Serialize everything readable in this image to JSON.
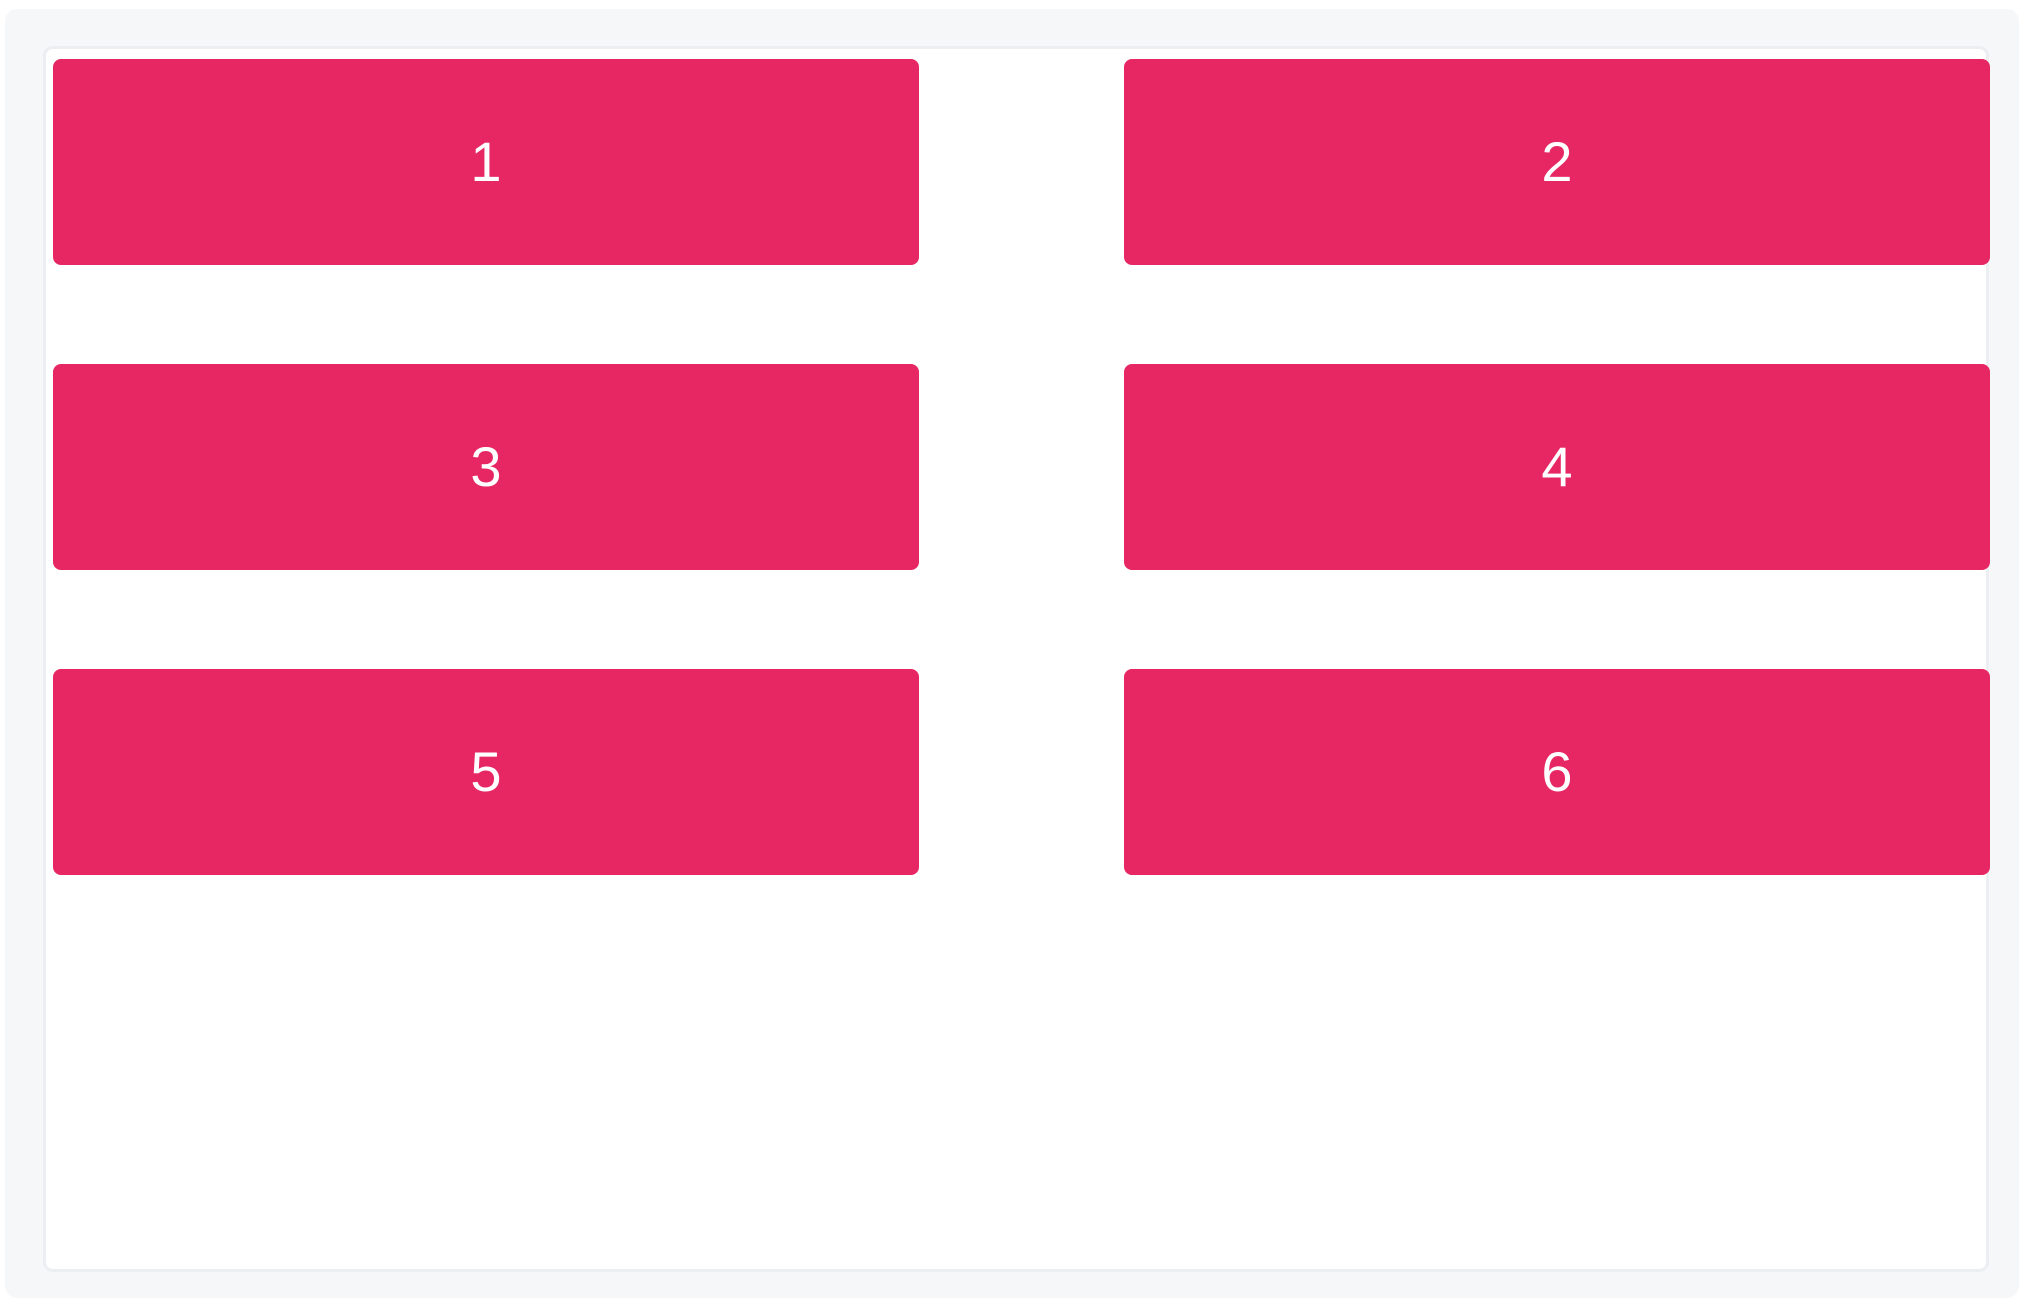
{
  "grid": {
    "accent_color": "#e72764",
    "tiles": [
      {
        "label": "1"
      },
      {
        "label": "2"
      },
      {
        "label": "3"
      },
      {
        "label": "4"
      },
      {
        "label": "5"
      },
      {
        "label": "6"
      }
    ]
  }
}
